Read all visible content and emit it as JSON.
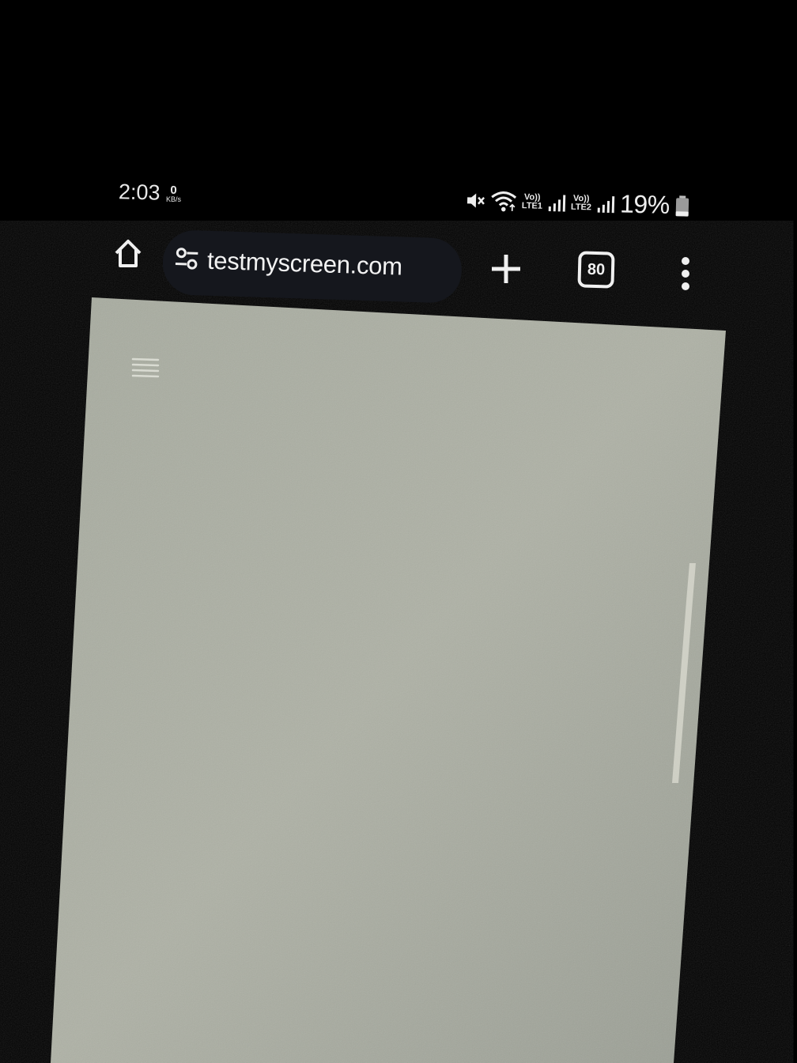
{
  "status_bar": {
    "time": "2:03",
    "net_speed_value": "0",
    "net_speed_unit": "KB/s",
    "sim1_label_top": "Vo))",
    "sim1_label_bottom": "LTE1",
    "sim2_label_top": "Vo))",
    "sim2_label_bottom": "LTE2",
    "battery_percent": "19%",
    "icons": [
      "mute-icon",
      "wifi-icon",
      "signal-icon",
      "signal-icon",
      "battery-icon"
    ]
  },
  "browser": {
    "url": "testmyscreen.com",
    "tab_count": "80",
    "icons": [
      "home-icon",
      "site-settings-icon",
      "plus-icon",
      "more-vert-icon"
    ]
  },
  "page": {
    "menu_icon": "hamburger-icon"
  },
  "colors": {
    "background": "#000000",
    "url_bar": "#15171d",
    "page_gray": "#a9ada2",
    "foreground": "#f0f0f0"
  }
}
